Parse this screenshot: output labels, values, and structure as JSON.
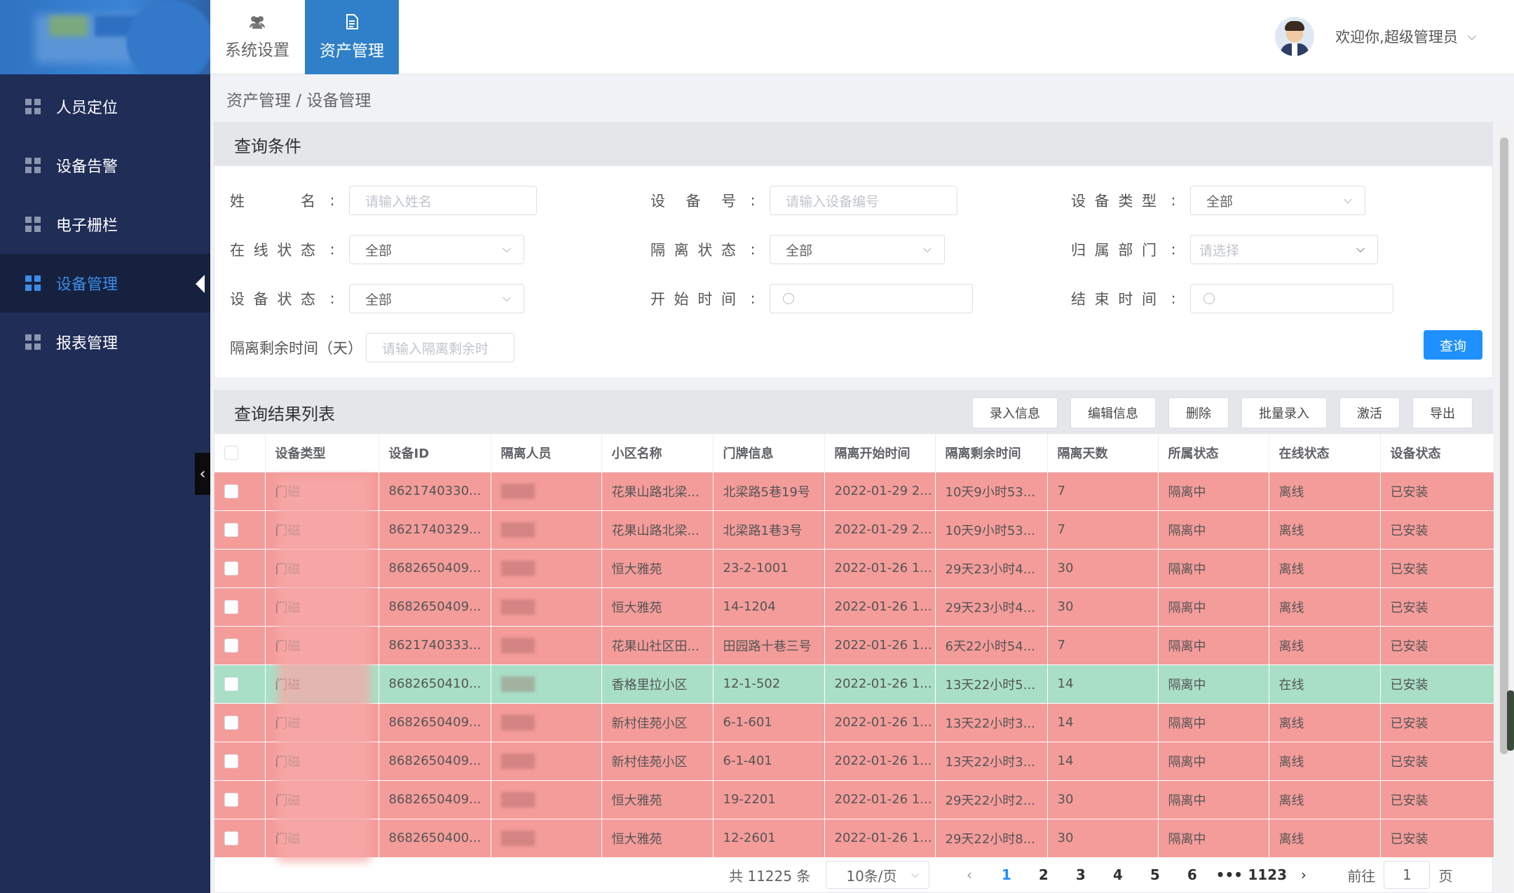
{
  "sidebar": {
    "items": [
      {
        "label": "人员定位"
      },
      {
        "label": "设备告警"
      },
      {
        "label": "电子栅栏"
      },
      {
        "label": "设备管理"
      },
      {
        "label": "报表管理"
      }
    ]
  },
  "topbar": {
    "tabs": [
      {
        "label": "系统设置",
        "icon": "users-icon"
      },
      {
        "label": "资产管理",
        "icon": "document-icon"
      }
    ],
    "welcome": "欢迎你,超级管理员"
  },
  "breadcrumb": "资产管理 / 设备管理",
  "query": {
    "title": "查询条件",
    "fields": {
      "name": {
        "label": "姓名",
        "placeholder": "请输入姓名"
      },
      "device_no": {
        "label": "设备号",
        "placeholder": "请输入设备编号"
      },
      "device_type": {
        "label": "设备类型",
        "value": "全部"
      },
      "online": {
        "label": "在线状态",
        "value": "全部"
      },
      "isolation": {
        "label": "隔离状态",
        "value": "全部"
      },
      "dept": {
        "label": "归属部门",
        "placeholder": "请选择"
      },
      "device_status": {
        "label": "设备状态",
        "value": "全部"
      },
      "start": {
        "label": "开始时间"
      },
      "end": {
        "label": "结束时间"
      },
      "remaining": {
        "label": "隔离剩余时间（天）",
        "placeholder": "请输入隔离剩余时"
      }
    },
    "submit": "查询"
  },
  "results": {
    "title": "查询结果列表",
    "actions": [
      "录入信息",
      "编辑信息",
      "删除",
      "批量录入",
      "激活",
      "导出"
    ],
    "columns": [
      "设备类型",
      "设备ID",
      "隔离人员",
      "小区名称",
      "门牌信息",
      "隔离开始时间",
      "隔离剩余时间",
      "隔离天数",
      "所属状态",
      "在线状态",
      "设备状态"
    ],
    "rows": [
      {
        "type": "门磁",
        "id": "8621740330...",
        "community": "花果山路北梁...",
        "door": "北梁路5巷19号",
        "start": "2022-01-29 2...",
        "remain": "10天9小时53...",
        "days": "7",
        "belong": "隔离中",
        "online": "离线",
        "status": "已安装",
        "color": "red"
      },
      {
        "type": "门磁",
        "id": "8621740329...",
        "community": "花果山路北梁...",
        "door": "北梁路1巷3号",
        "start": "2022-01-29 2...",
        "remain": "10天9小时53...",
        "days": "7",
        "belong": "隔离中",
        "online": "离线",
        "status": "已安装",
        "color": "red"
      },
      {
        "type": "门磁",
        "id": "8682650409...",
        "community": "恒大雅苑",
        "door": "23-2-1001",
        "start": "2022-01-26 1...",
        "remain": "29天23小时4...",
        "days": "30",
        "belong": "隔离中",
        "online": "离线",
        "status": "已安装",
        "color": "red"
      },
      {
        "type": "门磁",
        "id": "8682650409...",
        "community": "恒大雅苑",
        "door": "14-1204",
        "start": "2022-01-26 1...",
        "remain": "29天23小时4...",
        "days": "30",
        "belong": "隔离中",
        "online": "离线",
        "status": "已安装",
        "color": "red"
      },
      {
        "type": "门磁",
        "id": "8621740333...",
        "community": "花果山社区田...",
        "door": "田园路十巷三号",
        "start": "2022-01-26 1...",
        "remain": "6天22小时54...",
        "days": "7",
        "belong": "隔离中",
        "online": "离线",
        "status": "已安装",
        "color": "red"
      },
      {
        "type": "门磁",
        "id": "8682650410...",
        "community": "香格里拉小区",
        "door": "12-1-502",
        "start": "2022-01-26 1...",
        "remain": "13天22小时5...",
        "days": "14",
        "belong": "隔离中",
        "online": "在线",
        "status": "已安装",
        "color": "green"
      },
      {
        "type": "门磁",
        "id": "8682650409...",
        "community": "新村佳苑小区",
        "door": "6-1-601",
        "start": "2022-01-26 1...",
        "remain": "13天22小时3...",
        "days": "14",
        "belong": "隔离中",
        "online": "离线",
        "status": "已安装",
        "color": "red"
      },
      {
        "type": "门磁",
        "id": "8682650409...",
        "community": "新村佳苑小区",
        "door": "6-1-401",
        "start": "2022-01-26 1...",
        "remain": "13天22小时3...",
        "days": "14",
        "belong": "隔离中",
        "online": "离线",
        "status": "已安装",
        "color": "red"
      },
      {
        "type": "门磁",
        "id": "8682650409...",
        "community": "恒大雅苑",
        "door": "19-2201",
        "start": "2022-01-26 1...",
        "remain": "29天22小时2...",
        "days": "30",
        "belong": "隔离中",
        "online": "离线",
        "status": "已安装",
        "color": "red"
      },
      {
        "type": "门磁",
        "id": "8682650400...",
        "community": "恒大雅苑",
        "door": "12-2601",
        "start": "2022-01-26 1...",
        "remain": "29天22小时8...",
        "days": "30",
        "belong": "隔离中",
        "online": "离线",
        "status": "已安装",
        "color": "red"
      }
    ]
  },
  "pagination": {
    "total": "共 11225 条",
    "page_size": "10条/页",
    "pages": [
      "1",
      "2",
      "3",
      "4",
      "5",
      "6",
      "•••",
      "1123"
    ],
    "current": "1",
    "goto_label": "前往",
    "goto_value": "1",
    "page_unit": "页"
  },
  "colors": {
    "sidebar": "#1f2d57",
    "accent": "#1e90ff",
    "row_red": "#f49c9a",
    "row_green": "#a9dfc6"
  }
}
